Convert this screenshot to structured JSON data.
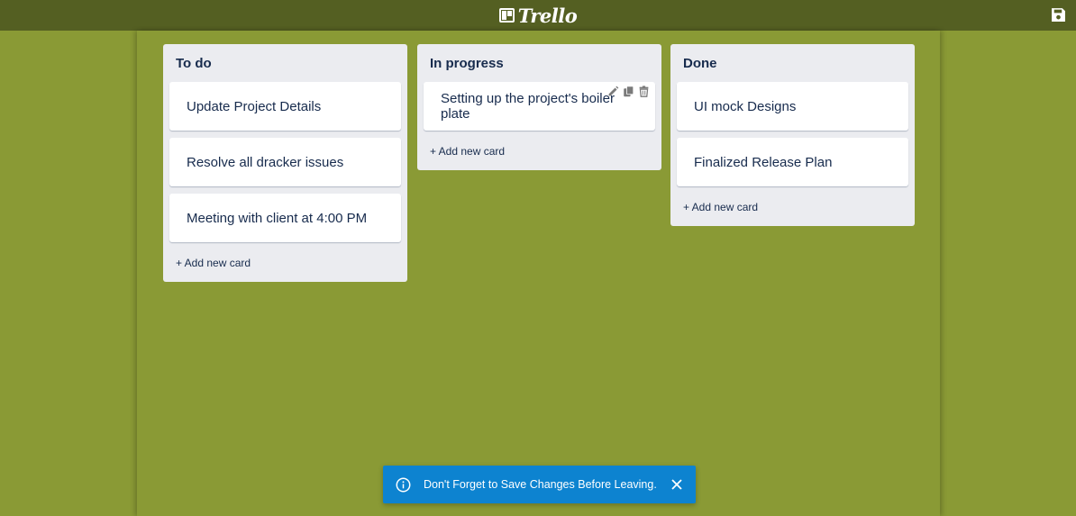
{
  "app": {
    "logo_text": "Trello"
  },
  "lists": [
    {
      "title": "To do",
      "cards": [
        "Update Project Details",
        "Resolve all dracker issues",
        "Meeting with client at 4:00 PM"
      ],
      "add_label": "+ Add new card"
    },
    {
      "title": "In progress",
      "cards": [
        "Setting up the project's boiler plate"
      ],
      "add_label": "+ Add new card"
    },
    {
      "title": "Done",
      "cards": [
        "UI mock Designs",
        "Finalized Release Plan"
      ],
      "add_label": "+ Add new card"
    }
  ],
  "toast": {
    "message": "Don't Forget to Save Changes Before Leaving.",
    "icon": "info-icon",
    "close_icon": "close-icon"
  },
  "colors": {
    "topbar": "#545f22",
    "board": "#8a9a35",
    "list": "#ebecf0",
    "toast": "#0d83d0"
  }
}
